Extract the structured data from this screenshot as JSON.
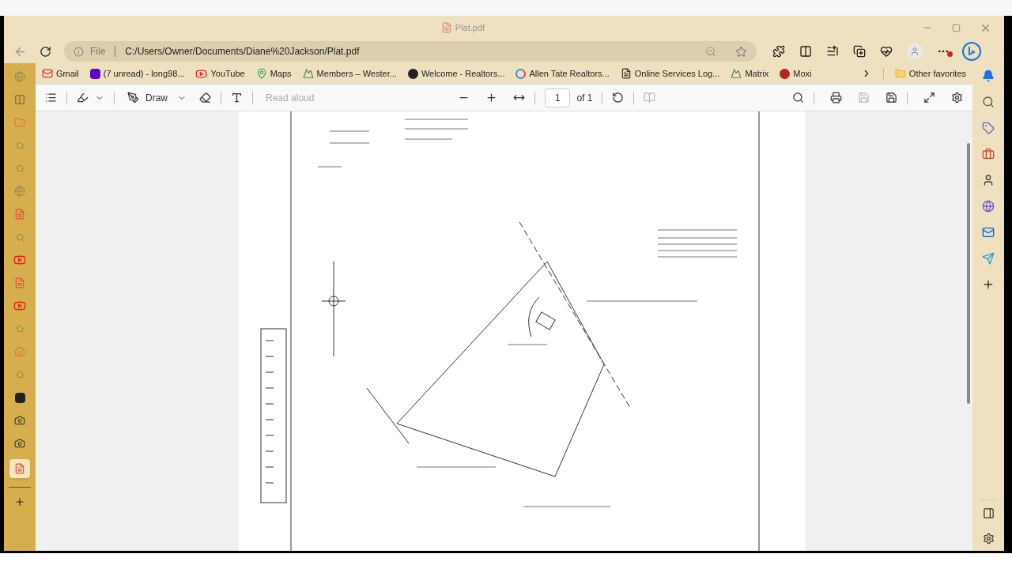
{
  "window": {
    "title": "Plat.pdf"
  },
  "address_bar": {
    "scheme": "File",
    "url": "C:/Users/Owner/Documents/Diane%20Jackson/Plat.pdf"
  },
  "bookmarks": [
    {
      "label": "Gmail",
      "kind": "gmail"
    },
    {
      "label": "(7 unread) - long98...",
      "kind": "yahoo"
    },
    {
      "label": "YouTube",
      "kind": "youtube"
    },
    {
      "label": "Maps",
      "kind": "maps"
    },
    {
      "label": "Members – Wester...",
      "kind": "mountain"
    },
    {
      "label": "Welcome - Realtors...",
      "kind": "realtors"
    },
    {
      "label": "Allen Tate Realtors...",
      "kind": "google"
    },
    {
      "label": "Online Services Log...",
      "kind": "page"
    },
    {
      "label": "Matrix",
      "kind": "mountain"
    },
    {
      "label": "Moxi",
      "kind": "moxi"
    }
  ],
  "other_favorites": "Other favorites",
  "pdf_toolbar": {
    "draw": "Draw",
    "read_aloud": {
      "label": "Read aloud",
      "disabled": true
    },
    "page": "1",
    "page_count": "of 1"
  },
  "vertical_tabs": [
    {
      "kind": "globe",
      "selected": false
    },
    {
      "kind": "split",
      "selected": false
    },
    {
      "kind": "folder",
      "selected": false
    },
    {
      "kind": "search",
      "selected": false
    },
    {
      "kind": "search",
      "selected": false
    },
    {
      "kind": "globe",
      "selected": false
    },
    {
      "kind": "pdf",
      "selected": false
    },
    {
      "kind": "search",
      "selected": false
    },
    {
      "kind": "youtube",
      "selected": false
    },
    {
      "kind": "pdf",
      "selected": false
    },
    {
      "kind": "youtube",
      "selected": false
    },
    {
      "kind": "search",
      "selected": false
    },
    {
      "kind": "home",
      "selected": false
    },
    {
      "kind": "search",
      "selected": false
    },
    {
      "kind": "b",
      "selected": false
    },
    {
      "kind": "camera",
      "selected": false
    },
    {
      "kind": "camera",
      "selected": false
    },
    {
      "kind": "pdf",
      "selected": true
    }
  ]
}
